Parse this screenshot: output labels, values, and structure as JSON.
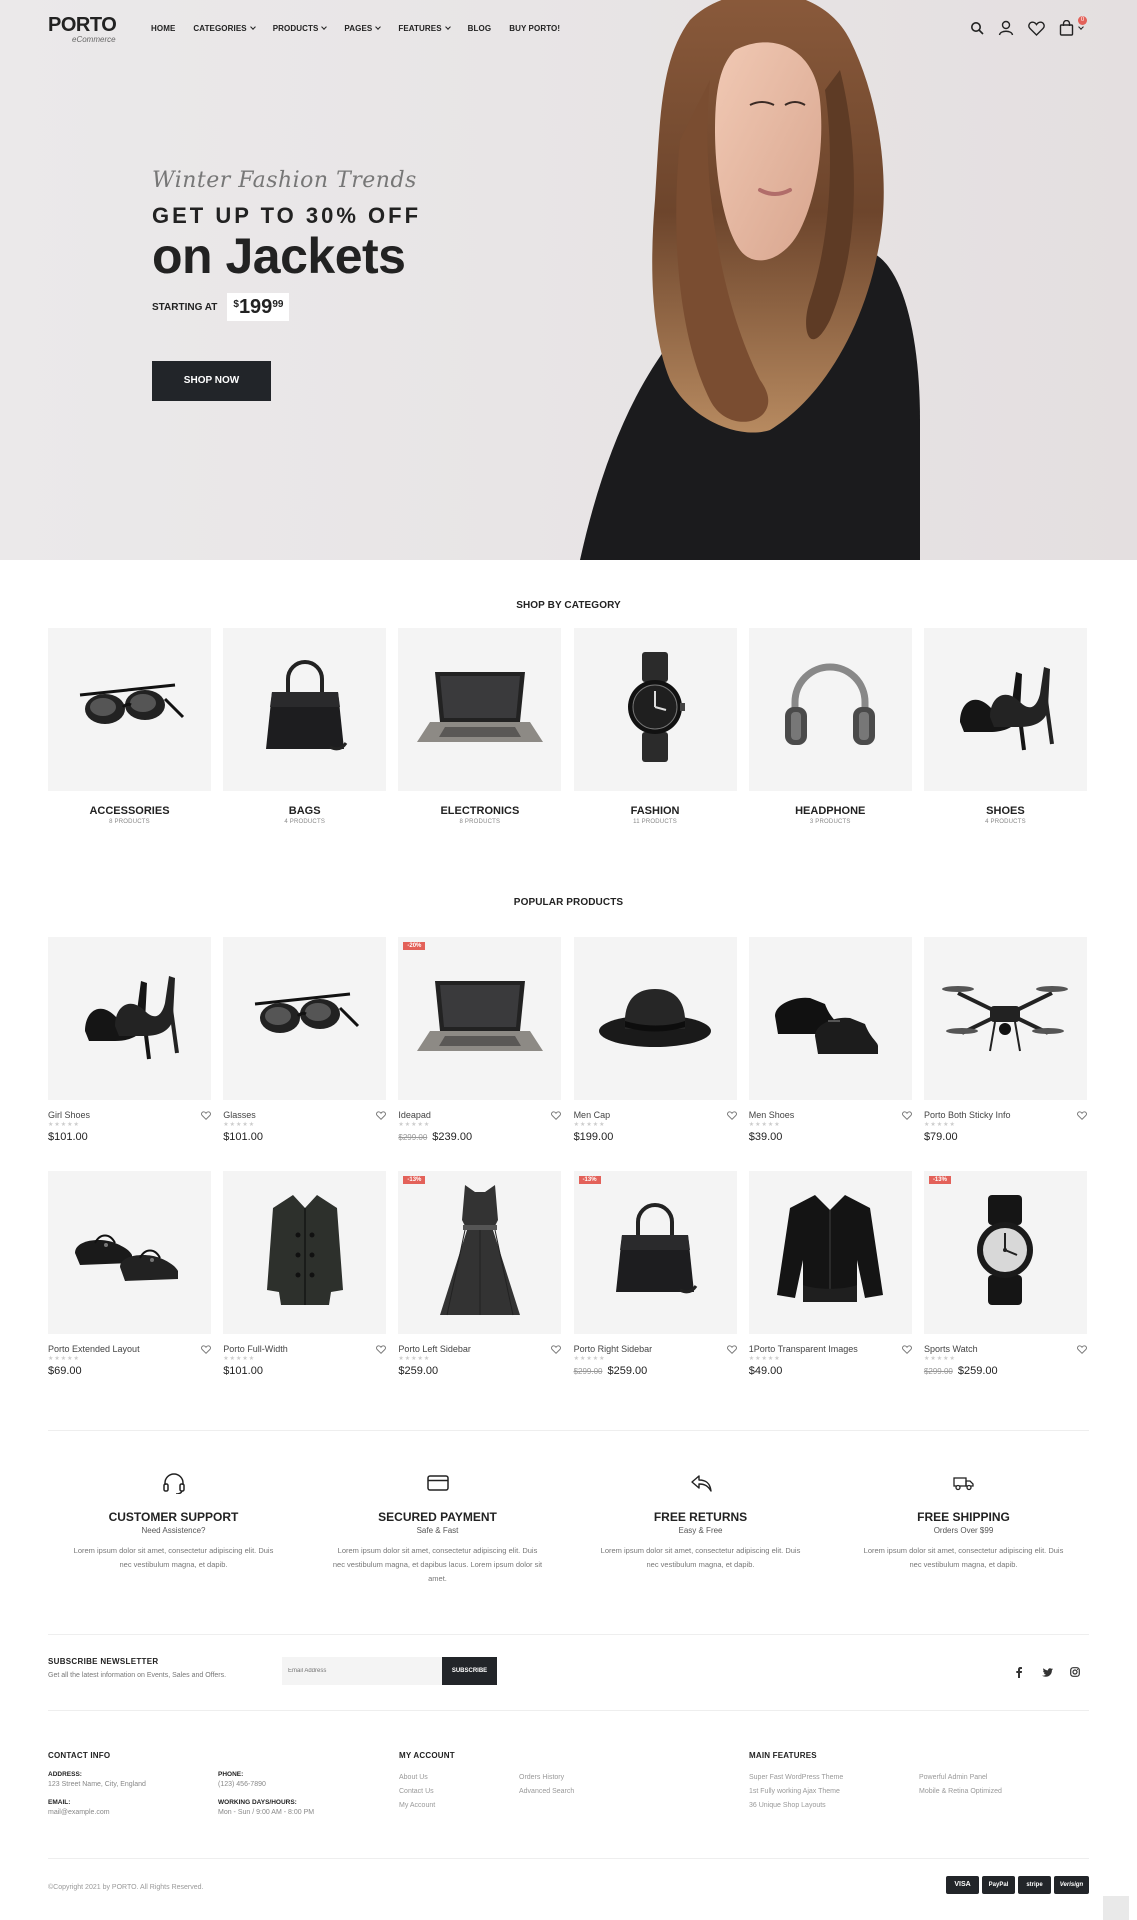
{
  "header": {
    "logo": "PORTO",
    "logo_sub": "eCommerce",
    "nav": [
      {
        "label": "HOME",
        "dropdown": false
      },
      {
        "label": "CATEGORIES",
        "dropdown": true
      },
      {
        "label": "PRODUCTS",
        "dropdown": true
      },
      {
        "label": "PAGES",
        "dropdown": true
      },
      {
        "label": "FEATURES",
        "dropdown": true
      },
      {
        "label": "BLOG",
        "dropdown": false
      },
      {
        "label": "BUY PORTO!",
        "dropdown": false
      }
    ],
    "cart_count": "0"
  },
  "hero": {
    "script": "Winter Fashion Trends",
    "line2": "GET UP TO 30% OFF",
    "line3": "on Jackets",
    "starting_label": "STARTING AT",
    "price_currency": "$",
    "price_int": "199",
    "price_cents": "99",
    "button": "SHOP NOW"
  },
  "categories": {
    "title": "SHOP BY CATEGORY",
    "items": [
      {
        "name": "ACCESSORIES",
        "count": "8 PRODUCTS",
        "icon": "sunglasses-icon"
      },
      {
        "name": "BAGS",
        "count": "4 PRODUCTS",
        "icon": "handbag-icon"
      },
      {
        "name": "ELECTRONICS",
        "count": "8 PRODUCTS",
        "icon": "laptop-icon"
      },
      {
        "name": "FASHION",
        "count": "11 PRODUCTS",
        "icon": "watch-icon"
      },
      {
        "name": "HEADPHONE",
        "count": "3 PRODUCTS",
        "icon": "headphone-icon"
      },
      {
        "name": "SHOES",
        "count": "4 PRODUCTS",
        "icon": "heels-icon"
      }
    ]
  },
  "popular": {
    "title": "POPULAR PRODUCTS",
    "row1": [
      {
        "name": "Girl Shoes",
        "old": "",
        "price": "$101.00",
        "sale": "",
        "rating": 0,
        "icon": "heels-icon"
      },
      {
        "name": "Glasses",
        "old": "",
        "price": "$101.00",
        "sale": "",
        "rating": 0,
        "icon": "sunglasses-icon"
      },
      {
        "name": "Ideapad",
        "old": "$299.00",
        "price": "$239.00",
        "sale": "-20%",
        "rating": 0,
        "icon": "laptop-icon"
      },
      {
        "name": "Men Cap",
        "old": "",
        "price": "$199.00",
        "sale": "",
        "rating": 0,
        "icon": "hat-icon"
      },
      {
        "name": "Men Shoes",
        "old": "",
        "price": "$39.00",
        "sale": "",
        "rating": 0,
        "icon": "men-shoes-icon"
      },
      {
        "name": "Porto Both Sticky Info",
        "old": "",
        "price": "$79.00",
        "sale": "",
        "rating": 0,
        "icon": "drone-icon"
      }
    ],
    "row2": [
      {
        "name": "Porto Extended Layout",
        "old": "",
        "price": "$69.00",
        "sale": "",
        "rating": 0,
        "icon": "flats-icon"
      },
      {
        "name": "Porto Full-Width",
        "old": "",
        "price": "$101.00",
        "sale": "",
        "rating": 0,
        "icon": "coat-icon"
      },
      {
        "name": "Porto Left Sidebar",
        "old": "",
        "price": "$259.00",
        "sale": "-13%",
        "rating": 0,
        "icon": "dress-icon"
      },
      {
        "name": "Porto Right Sidebar",
        "old": "$299.00",
        "price": "$259.00",
        "sale": "-13%",
        "rating": 0,
        "icon": "handbag-icon"
      },
      {
        "name": "1Porto Transparent Images",
        "old": "",
        "price": "$49.00",
        "sale": "",
        "rating": 0,
        "icon": "jacket-icon"
      },
      {
        "name": "Sports Watch",
        "old": "$299.00",
        "price": "$259.00",
        "sale": "-13%",
        "rating": 0,
        "icon": "sports-watch-icon"
      }
    ]
  },
  "features": [
    {
      "title": "CUSTOMER SUPPORT",
      "sub": "Need Assistence?",
      "text": "Lorem ipsum dolor sit amet, consectetur adipiscing elit. Duis nec vestibulum magna, et dapib.",
      "icon": "headset-icon"
    },
    {
      "title": "SECURED PAYMENT",
      "sub": "Safe & Fast",
      "text": "Lorem ipsum dolor sit amet, consectetur adipiscing elit. Duis nec vestibulum magna, et dapibus lacus. Lorem ipsum dolor sit amet.",
      "icon": "credit-card-icon"
    },
    {
      "title": "FREE RETURNS",
      "sub": "Easy & Free",
      "text": "Lorem ipsum dolor sit amet, consectetur adipiscing elit. Duis nec vestibulum magna, et dapib.",
      "icon": "return-arrow-icon"
    },
    {
      "title": "FREE SHIPPING",
      "sub": "Orders Over $99",
      "text": "Lorem ipsum dolor sit amet, consectetur adipiscing elit. Duis nec vestibulum magna, et dapib.",
      "icon": "truck-icon"
    }
  ],
  "newsletter": {
    "title": "SUBSCRIBE NEWSLETTER",
    "sub": "Get all the latest information on Events, Sales and Offers.",
    "placeholder": "Email Address",
    "button": "SUBSCRIBE"
  },
  "footer": {
    "contact_head": "CONTACT INFO",
    "address_lbl": "ADDRESS:",
    "address": "123 Street Name, City, England",
    "phone_lbl": "PHONE:",
    "phone": "(123) 456-7890",
    "email_lbl": "EMAIL:",
    "email": "mail@example.com",
    "hours_lbl": "WORKING DAYS/HOURS:",
    "hours": "Mon - Sun / 9:00 AM - 8:00 PM",
    "account_head": "MY ACCOUNT",
    "account_links_1": [
      "About Us",
      "Contact Us",
      "My Account"
    ],
    "account_links_2": [
      "Orders History",
      "Advanced Search"
    ],
    "features_head": "MAIN FEATURES",
    "features_links_1": [
      "Super Fast WordPress Theme",
      "1st Fully working Ajax Theme",
      "36 Unique Shop Layouts"
    ],
    "features_links_2": [
      "Powerful Admin Panel",
      "Mobile & Retina Optimized"
    ],
    "copyright": "©Copyright 2021 by PORTO. All Rights Reserved.",
    "payments": [
      "VISA",
      "PayPal",
      "stripe",
      "Verisign"
    ]
  },
  "colors": {
    "accent": "#e36159",
    "dark": "#222529"
  }
}
